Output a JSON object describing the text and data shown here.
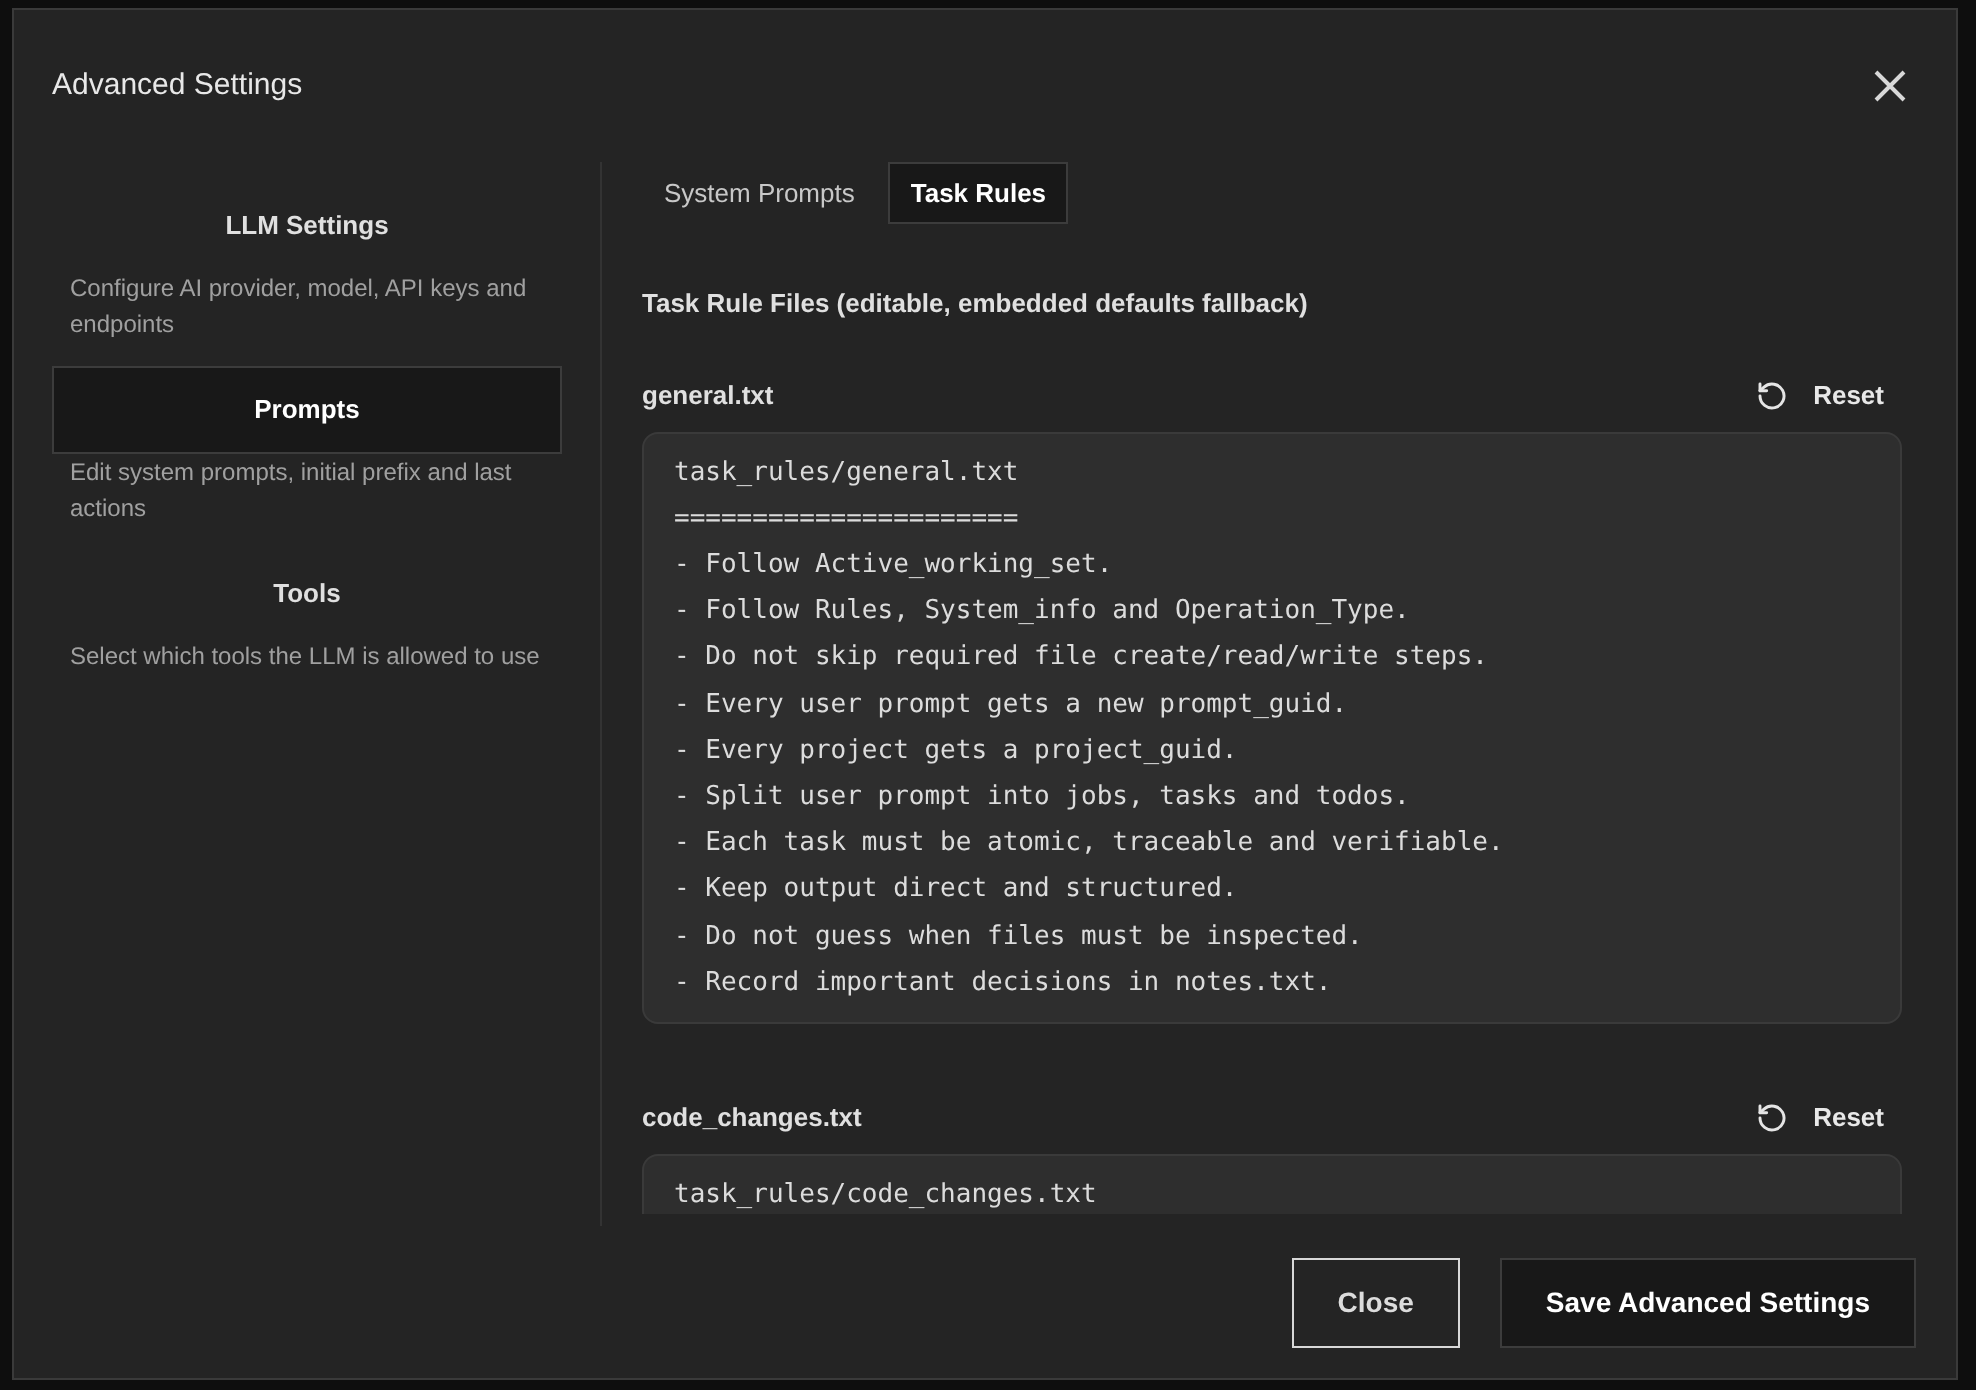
{
  "dialog": {
    "title": "Advanced Settings"
  },
  "sidebar": {
    "items": [
      {
        "label": "LLM Settings",
        "description": "Configure AI provider, model, API keys and endpoints",
        "selected": false
      },
      {
        "label": "Prompts",
        "description": "Edit system prompts, initial prefix and last actions",
        "selected": true
      },
      {
        "label": "Tools",
        "description": "Select which tools the LLM is allowed to use",
        "selected": false
      }
    ]
  },
  "tabs": [
    {
      "label": "System Prompts",
      "selected": false
    },
    {
      "label": "Task Rules",
      "selected": true
    }
  ],
  "section_title": "Task Rule Files (editable, embedded defaults fallback)",
  "files": [
    {
      "name": "general.txt",
      "reset_label": "Reset",
      "lines": [
        "task_rules/general.txt",
        "======================",
        "- Follow Active_working_set.",
        "- Follow Rules, System_info and Operation_Type.",
        "- Do not skip required file create/read/write steps.",
        "- Every user prompt gets a new prompt_guid.",
        "- Every project gets a project_guid.",
        "- Split user prompt into jobs, tasks and todos.",
        "- Each task must be atomic, traceable and verifiable.",
        "- Keep output direct and structured.",
        "- Do not guess when files must be inspected.",
        "- Record important decisions in notes.txt."
      ]
    },
    {
      "name": "code_changes.txt",
      "reset_label": "Reset",
      "lines": [
        "task_rules/code_changes.txt"
      ]
    }
  ],
  "footer": {
    "buttons": [
      {
        "label": "Close",
        "kind": "outline"
      },
      {
        "label": "Save Advanced Settings",
        "kind": "primary"
      }
    ]
  }
}
